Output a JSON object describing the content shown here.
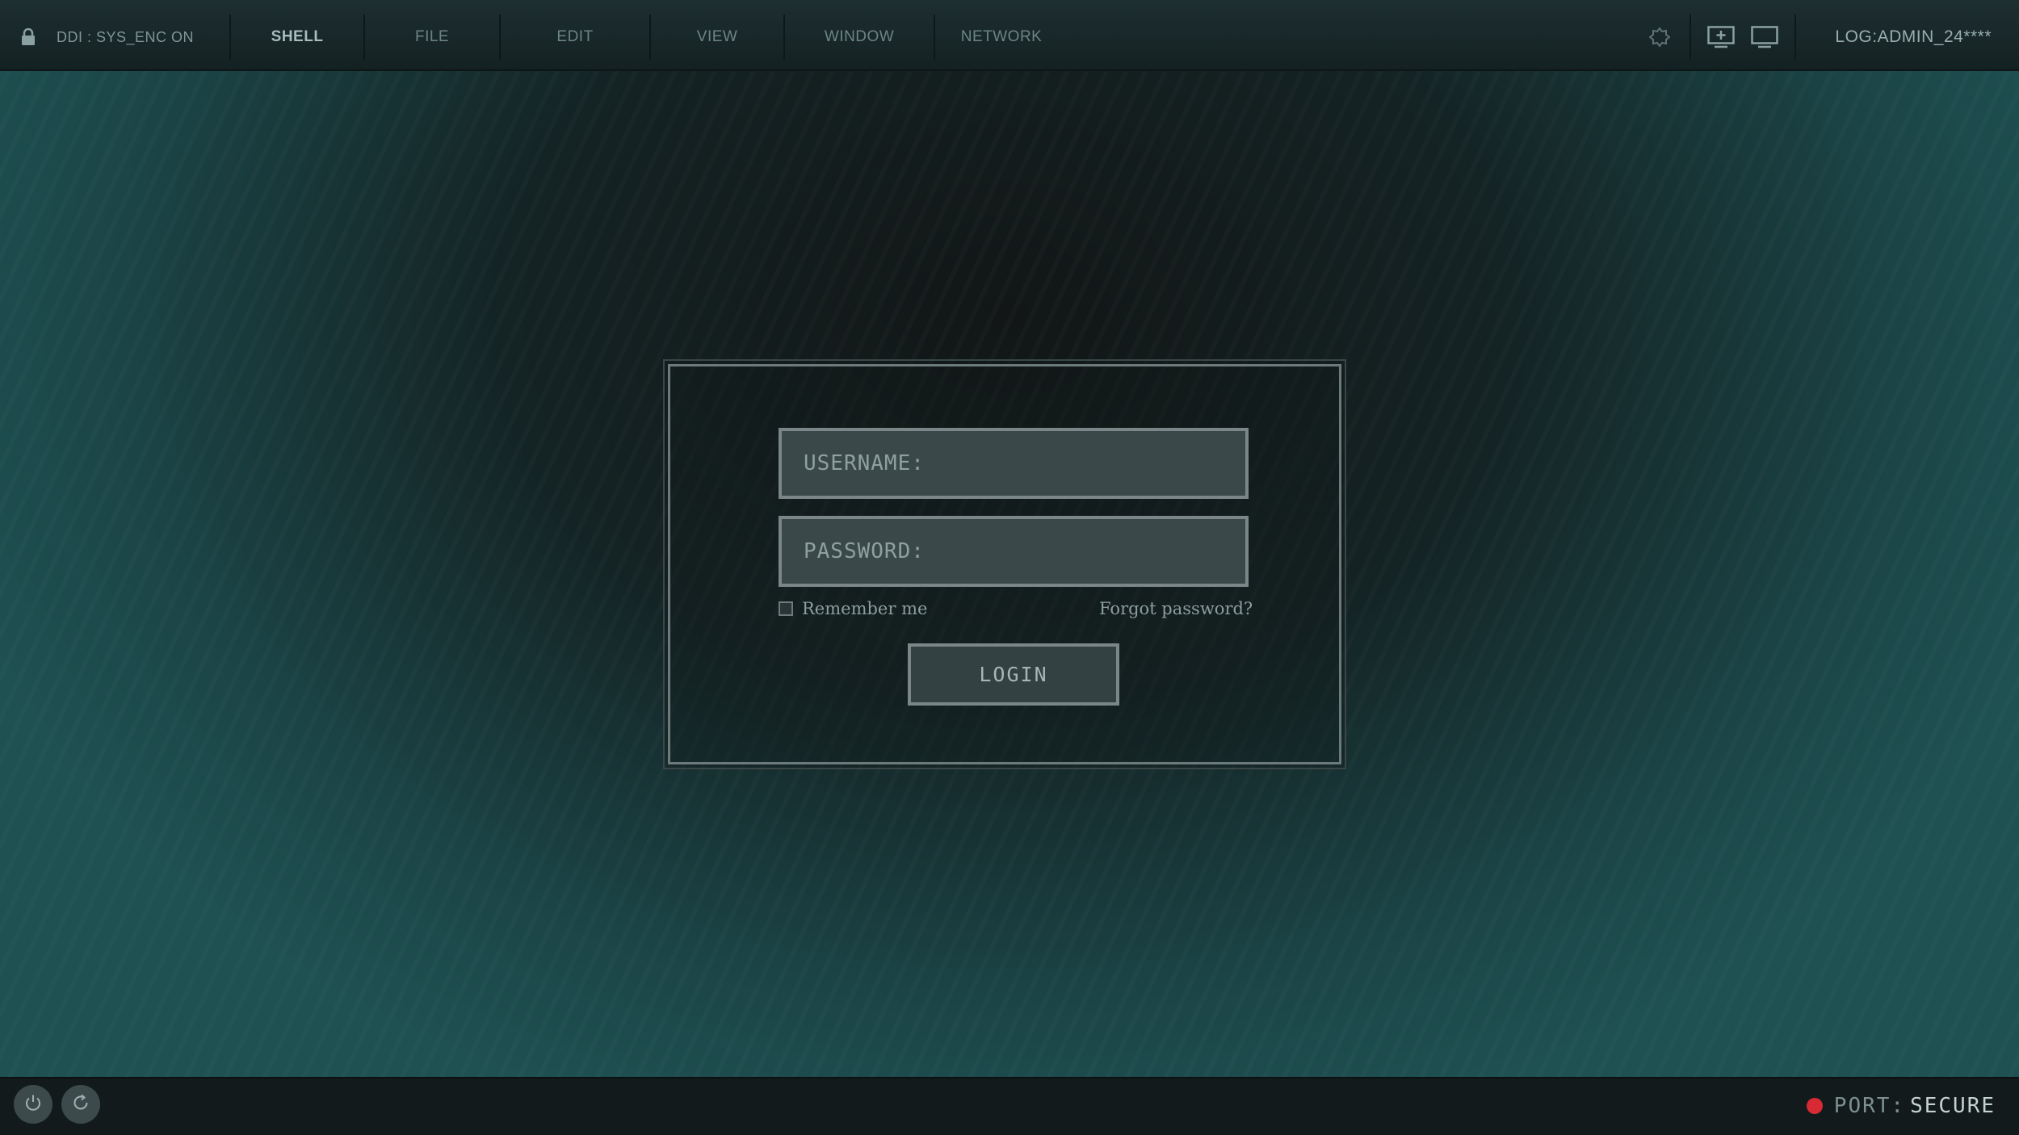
{
  "topbar": {
    "system_label": "DDI : SYS_ENC ON",
    "menu": [
      {
        "label": "SHELL",
        "active": true
      },
      {
        "label": "FILE",
        "active": false
      },
      {
        "label": "EDIT",
        "active": false
      },
      {
        "label": "VIEW",
        "active": false
      },
      {
        "label": "WINDOW",
        "active": false
      },
      {
        "label": "NETWORK",
        "active": false
      }
    ],
    "user_label": "LOG:ADMIN_24****",
    "icons": [
      "lock-icon",
      "settings-icon",
      "add-display-icon",
      "display-icon"
    ]
  },
  "login": {
    "username_label": "USERNAME:",
    "username_value": "",
    "password_label": "PASSWORD:",
    "password_value": "",
    "remember_label": "Remember me",
    "remember_checked": false,
    "forgot_label": "Forgot password?",
    "login_label": "LOGIN"
  },
  "bottombar": {
    "icons": [
      "power-icon",
      "refresh-icon"
    ],
    "port_label": "PORT:",
    "port_value": "SECURE",
    "status_color": "#d72a35"
  },
  "colors": {
    "accent": "#1f5152",
    "field_bg": "#3a4849",
    "status_red": "#d72a35"
  }
}
